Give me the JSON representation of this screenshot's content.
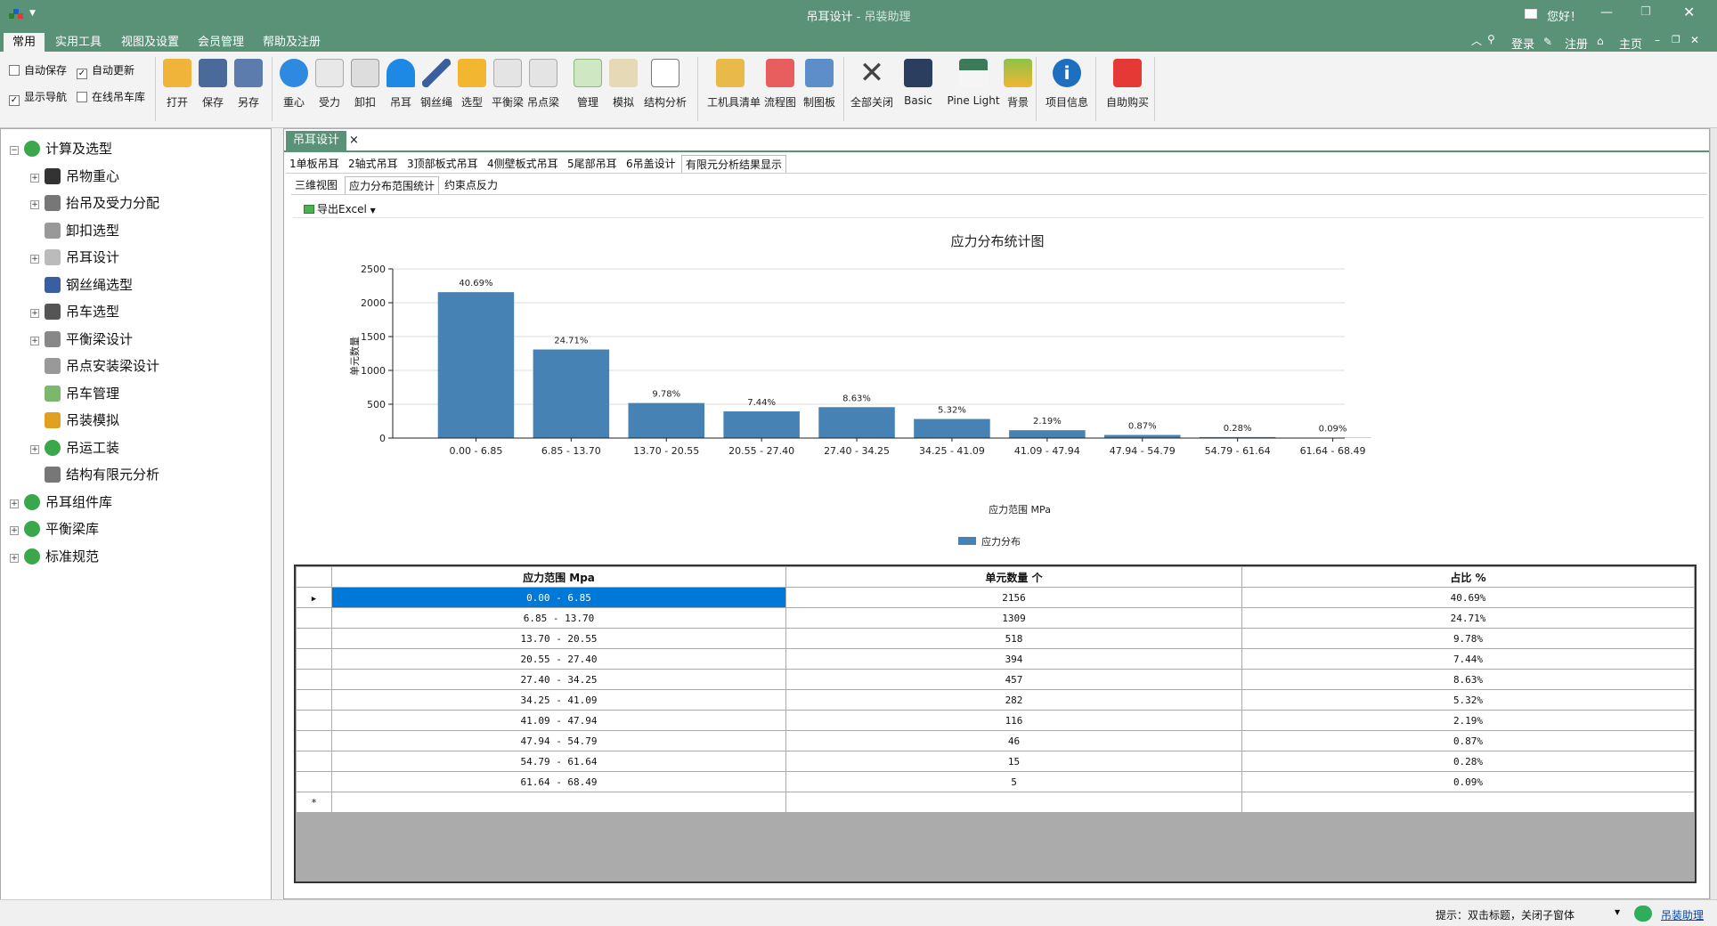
{
  "window": {
    "title": "吊耳设计",
    "title_sep": " - ",
    "subtitle": "吊装助理",
    "greeting": "您好！"
  },
  "menu": [
    {
      "label": "常用",
      "active": true
    },
    {
      "label": "实用工具"
    },
    {
      "label": "视图及设置"
    },
    {
      "label": "会员管理"
    },
    {
      "label": "帮助及注册"
    }
  ],
  "menu_right": {
    "login": "登录",
    "register": "注册",
    "home": "主页"
  },
  "ribbon_checks": [
    {
      "label": "自动保存",
      "checked": false
    },
    {
      "label": "自动更新",
      "checked": true
    },
    {
      "label": "显示导航",
      "checked": true
    },
    {
      "label": "在线吊车库",
      "checked": false
    }
  ],
  "ribbon_buttons": [
    "打开",
    "保存",
    "另存",
    "重心",
    "受力",
    "卸扣",
    "吊耳",
    "钢丝绳",
    "选型",
    "平衡梁",
    "吊点梁",
    "管理",
    "模拟",
    "结构分析",
    "工机具清单",
    "流程图",
    "制图板",
    "全部关闭",
    "Basic",
    "Pine Light",
    "背景",
    "项目信息",
    "自助购买"
  ],
  "nav": [
    {
      "label": "计算及选型",
      "level": 0,
      "exp": "⊟",
      "icon": "gear-group-icon"
    },
    {
      "label": "吊物重心",
      "level": 1,
      "exp": "⊞",
      "icon": "center-of-gravity-icon"
    },
    {
      "label": "抬吊及受力分配",
      "level": 1,
      "exp": "⊞",
      "icon": "force-icon"
    },
    {
      "label": "卸扣选型",
      "level": 1,
      "exp": "",
      "icon": "shackle-icon"
    },
    {
      "label": "吊耳设计",
      "level": 1,
      "exp": "⊞",
      "icon": "lug-icon"
    },
    {
      "label": "钢丝绳选型",
      "level": 1,
      "exp": "",
      "icon": "wire-rope-icon"
    },
    {
      "label": "吊车选型",
      "level": 1,
      "exp": "⊞",
      "icon": "crane-icon"
    },
    {
      "label": "平衡梁设计",
      "level": 1,
      "exp": "⊞",
      "icon": "beam-icon"
    },
    {
      "label": "吊点安装梁设计",
      "level": 1,
      "exp": "",
      "icon": "point-beam-icon"
    },
    {
      "label": "吊车管理",
      "level": 1,
      "exp": "",
      "icon": "crane-manage-icon"
    },
    {
      "label": "吊装模拟",
      "level": 1,
      "exp": "",
      "icon": "simulation-icon"
    },
    {
      "label": "吊运工装",
      "level": 1,
      "exp": "⊞",
      "icon": "gear-group-icon"
    },
    {
      "label": "结构有限元分析",
      "level": 1,
      "exp": "",
      "icon": "analysis-icon"
    },
    {
      "label": "吊耳组件库",
      "level": 0,
      "exp": "⊞",
      "icon": "gear-group-icon"
    },
    {
      "label": "平衡梁库",
      "level": 0,
      "exp": "⊞",
      "icon": "gear-group-icon"
    },
    {
      "label": "标准规范",
      "level": 0,
      "exp": "⊞",
      "icon": "gear-group-icon"
    }
  ],
  "doc_tab": {
    "label": "吊耳设计",
    "close": "×"
  },
  "design_tabs": [
    "1单板吊耳",
    "2轴式吊耳",
    "3顶部板式吊耳",
    "4侧壁板式吊耳",
    "5尾部吊耳",
    "6吊盖设计",
    "有限元分析结果显示"
  ],
  "result_tabs": [
    "三维视图",
    "应力分布范围统计",
    "约束点反力"
  ],
  "export_label": "导出Excel",
  "chart_data": {
    "type": "bar",
    "title": "应力分布统计图",
    "xlabel": "应力范围 MPa",
    "ylabel": "单元数量",
    "categories": [
      "0.00 - 6.85",
      "6.85 - 13.70",
      "13.70 - 20.55",
      "20.55 - 27.40",
      "27.40 - 34.25",
      "34.25 - 41.09",
      "41.09 - 47.94",
      "47.94 - 54.79",
      "54.79 - 61.64",
      "61.64 - 68.49"
    ],
    "series": [
      {
        "name": "应力分布",
        "values": [
          2156,
          1309,
          518,
          394,
          457,
          282,
          116,
          46,
          15,
          5
        ],
        "color": "#4682b4"
      }
    ],
    "data_labels": [
      "40.69%",
      "24.71%",
      "9.78%",
      "7.44%",
      "8.63%",
      "5.32%",
      "2.19%",
      "0.87%",
      "0.28%",
      "0.09%"
    ],
    "ylim": [
      0,
      2500
    ],
    "yticks": [
      0,
      500,
      1000,
      1500,
      2000,
      2500
    ],
    "grid": true,
    "legend": "bottom-center"
  },
  "table": {
    "headers": [
      "应力范围 Mpa",
      "单元数量 个",
      "占比 %"
    ],
    "rows": [
      [
        "0.00 - 6.85",
        "2156",
        "40.69%"
      ],
      [
        "6.85 - 13.70",
        "1309",
        "24.71%"
      ],
      [
        "13.70 - 20.55",
        "518",
        "9.78%"
      ],
      [
        "20.55 - 27.40",
        "394",
        "7.44%"
      ],
      [
        "27.40 - 34.25",
        "457",
        "8.63%"
      ],
      [
        "34.25 - 41.09",
        "282",
        "5.32%"
      ],
      [
        "41.09 - 47.94",
        "116",
        "2.19%"
      ],
      [
        "47.94 - 54.79",
        "46",
        "0.87%"
      ],
      [
        "54.79 - 61.64",
        "15",
        "0.28%"
      ],
      [
        "61.64 - 68.49",
        "5",
        "0.09%"
      ]
    ],
    "new_row_marker": "*"
  },
  "status": {
    "hint": "提示：双击标题，关闭子窗体",
    "link": "吊装助理"
  },
  "colors": {
    "title_bg": "#5a9278",
    "accent": "#0078d7",
    "bar": "#4682b4"
  }
}
